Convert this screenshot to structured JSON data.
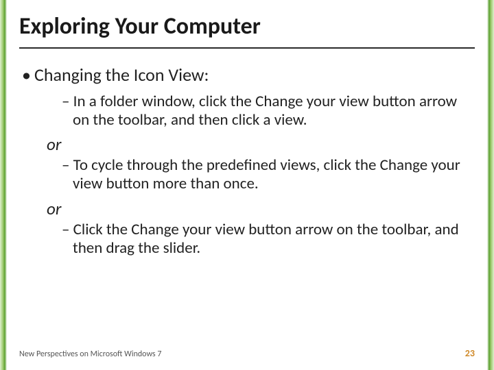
{
  "title": "Exploring Your Computer",
  "content": {
    "heading": "Changing the Icon View:",
    "items": [
      "In a folder window, click the Change your view button arrow on the toolbar, and then click a view.",
      "To cycle through the predefined views, click the Change your view button more than once.",
      "Click the Change your view button arrow on the toolbar, and then drag the slider."
    ],
    "separator": "or"
  },
  "footer": {
    "left": "New Perspectives on Microsoft Windows 7",
    "pagenum": "23"
  }
}
